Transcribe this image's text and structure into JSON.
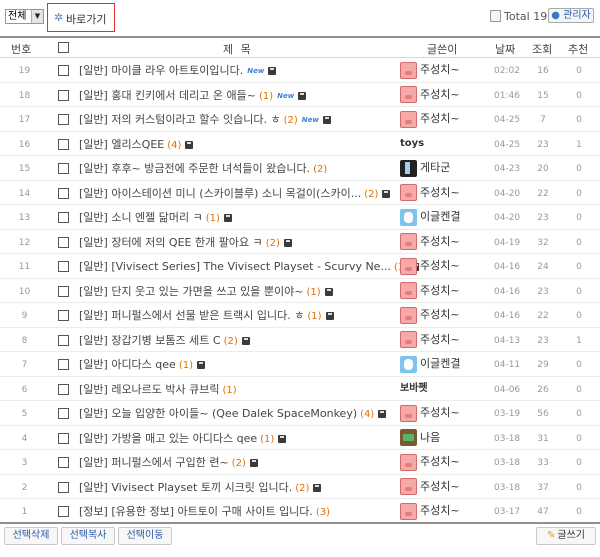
{
  "toolbar": {
    "category_value": "전체",
    "shortcut_label": "바로가기",
    "total_label": "Total",
    "total_count": "19",
    "admin_label": "관리자"
  },
  "columns": {
    "num": "번호",
    "subject": "제  목",
    "author": "글쓴이",
    "date": "날짜",
    "views": "조회",
    "rec": "추천"
  },
  "icons": {
    "new_badge": "New"
  },
  "rows": [
    {
      "num": "19",
      "subject": "[일반] 마이클 라우 아트토이입니다.",
      "comments": "",
      "new": true,
      "file": true,
      "author": "주성치~",
      "avatar": "pig",
      "date": "02:02",
      "views": "16",
      "rec": "0"
    },
    {
      "num": "18",
      "subject": "[일반] 홍대 킨키에서 데리고 온 애들~",
      "comments": "(1)",
      "new": true,
      "file": true,
      "author": "주성치~",
      "avatar": "pig",
      "date": "01:46",
      "views": "15",
      "rec": "0"
    },
    {
      "num": "17",
      "subject": "[일반] 저의 커스텀이라고 할수 잇습니다. ㅎ",
      "comments": "(2)",
      "new": true,
      "file": true,
      "author": "주성치~",
      "avatar": "pig",
      "date": "04-25",
      "views": "7",
      "rec": "0"
    },
    {
      "num": "16",
      "subject": "[일반] 엘리스QEE",
      "comments": "(4)",
      "new": false,
      "file": true,
      "author": "toys",
      "avatar": "",
      "date": "04-25",
      "views": "23",
      "rec": "1"
    },
    {
      "num": "15",
      "subject": "[일반] 후후~ 방금전에 주문한 녀석들이 왔습니다.",
      "comments": "(2)",
      "new": false,
      "file": false,
      "author": "게타군",
      "avatar": "dark",
      "date": "04-23",
      "views": "20",
      "rec": "0"
    },
    {
      "num": "14",
      "subject": "[일반] 아이스테이션 미니 (스카이블루) 소니 목걸이(스카이...",
      "comments": "(2)",
      "new": false,
      "file": true,
      "author": "주성치~",
      "avatar": "pig",
      "date": "04-20",
      "views": "22",
      "rec": "0"
    },
    {
      "num": "13",
      "subject": "[일반] 소니 엔젤 닮머리 ㅋ",
      "comments": "(1)",
      "new": false,
      "file": true,
      "author": "이글켄결",
      "avatar": "blue",
      "date": "04-20",
      "views": "23",
      "rec": "0"
    },
    {
      "num": "12",
      "subject": "[일반] 장터에 저의 QEE 한개 팔아요 ㅋ",
      "comments": "(2)",
      "new": false,
      "file": true,
      "author": "주성치~",
      "avatar": "pig",
      "date": "04-19",
      "views": "32",
      "rec": "0"
    },
    {
      "num": "11",
      "subject": "[일반] [Vivisect Series] The Vivisect Playset - Scurvy Ne...",
      "comments": "(3)",
      "new": false,
      "file": true,
      "author": "주성치~",
      "avatar": "pig",
      "date": "04-16",
      "views": "24",
      "rec": "0"
    },
    {
      "num": "10",
      "subject": "[일반] 단지 웃고 있는 가면을 쓰고 있을 뿐이야~",
      "comments": "(1)",
      "new": false,
      "file": true,
      "author": "주성치~",
      "avatar": "pig",
      "date": "04-16",
      "views": "23",
      "rec": "0"
    },
    {
      "num": "9",
      "subject": "[일반] 퍼니펄스에서 선물 받은 트랙시 입니다. ㅎ",
      "comments": "(1)",
      "new": false,
      "file": true,
      "author": "주성치~",
      "avatar": "pig",
      "date": "04-16",
      "views": "22",
      "rec": "0"
    },
    {
      "num": "8",
      "subject": "[일반] 장갑기병 보톰즈 세트 C",
      "comments": "(2)",
      "new": false,
      "file": true,
      "author": "주성치~",
      "avatar": "pig",
      "date": "04-13",
      "views": "23",
      "rec": "1"
    },
    {
      "num": "7",
      "subject": "[일반] 아디다스 qee",
      "comments": "(1)",
      "new": false,
      "file": true,
      "author": "이글켄결",
      "avatar": "blue",
      "date": "04-11",
      "views": "29",
      "rec": "0"
    },
    {
      "num": "6",
      "subject": "[일반] 레오나르도 박사 큐브릭",
      "comments": "(1)",
      "new": false,
      "file": false,
      "author": "보바펫",
      "avatar": "",
      "date": "04-06",
      "views": "26",
      "rec": "0"
    },
    {
      "num": "5",
      "subject": "[일반] 오늘 입양한 아이들~ (Qee Dalek SpaceMonkey)",
      "comments": "(4)",
      "new": false,
      "file": true,
      "author": "주성치~",
      "avatar": "pig",
      "date": "03-19",
      "views": "56",
      "rec": "0"
    },
    {
      "num": "4",
      "subject": "[일반] 가방을 매고 있는 아디다스 qee",
      "comments": "(1)",
      "new": false,
      "file": true,
      "author": "나음",
      "avatar": "green",
      "date": "03-18",
      "views": "31",
      "rec": "0"
    },
    {
      "num": "3",
      "subject": "[일반] 퍼니펄스에서 구입한 련~",
      "comments": "(2)",
      "new": false,
      "file": true,
      "author": "주성치~",
      "avatar": "pig",
      "date": "03-18",
      "views": "33",
      "rec": "0"
    },
    {
      "num": "2",
      "subject": "[일반] Vivisect Playset 토끼 시크릿 입니다.",
      "comments": "(2)",
      "new": false,
      "file": true,
      "author": "주성치~",
      "avatar": "pig",
      "date": "03-18",
      "views": "37",
      "rec": "0"
    },
    {
      "num": "1",
      "subject": "[정보] [유용한 정보] 아트토이 구매 사이트 입니다.",
      "comments": "(3)",
      "new": false,
      "file": false,
      "author": "주성치~",
      "avatar": "pig",
      "date": "03-17",
      "views": "47",
      "rec": "0"
    }
  ],
  "footer": {
    "delete_label": "선택삭제",
    "copy_label": "선택복사",
    "move_label": "선택이동",
    "write_label": "글쓰기"
  }
}
